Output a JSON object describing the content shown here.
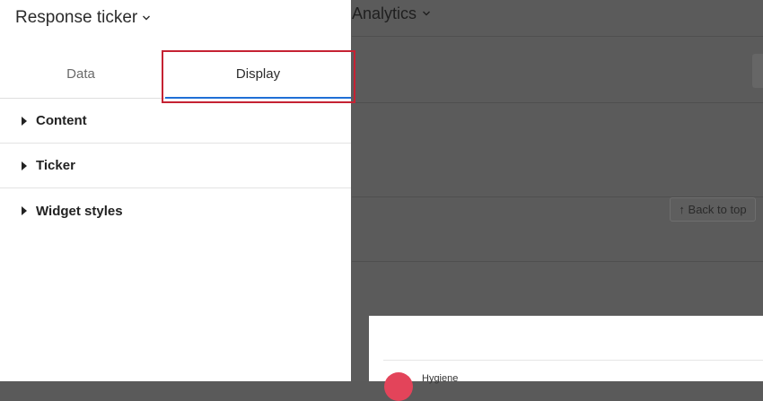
{
  "background": {
    "title": "Analytics",
    "back_to_top": "↑ Back to top",
    "card_label": "Hygiene",
    "card_dot_color": "#e3445a"
  },
  "panel": {
    "title": "Response ticker",
    "tabs": [
      {
        "label": "Data",
        "active": false
      },
      {
        "label": "Display",
        "active": true
      }
    ],
    "sections": [
      {
        "label": "Content"
      },
      {
        "label": "Ticker"
      },
      {
        "label": "Widget styles"
      }
    ]
  },
  "colors": {
    "accent": "#1f6fd6",
    "highlight_border": "#c52233",
    "overlay": "#5b5b5b"
  },
  "icons": {
    "title_dropdown": "chevron-down-icon",
    "section_caret": "caret-right-icon"
  }
}
